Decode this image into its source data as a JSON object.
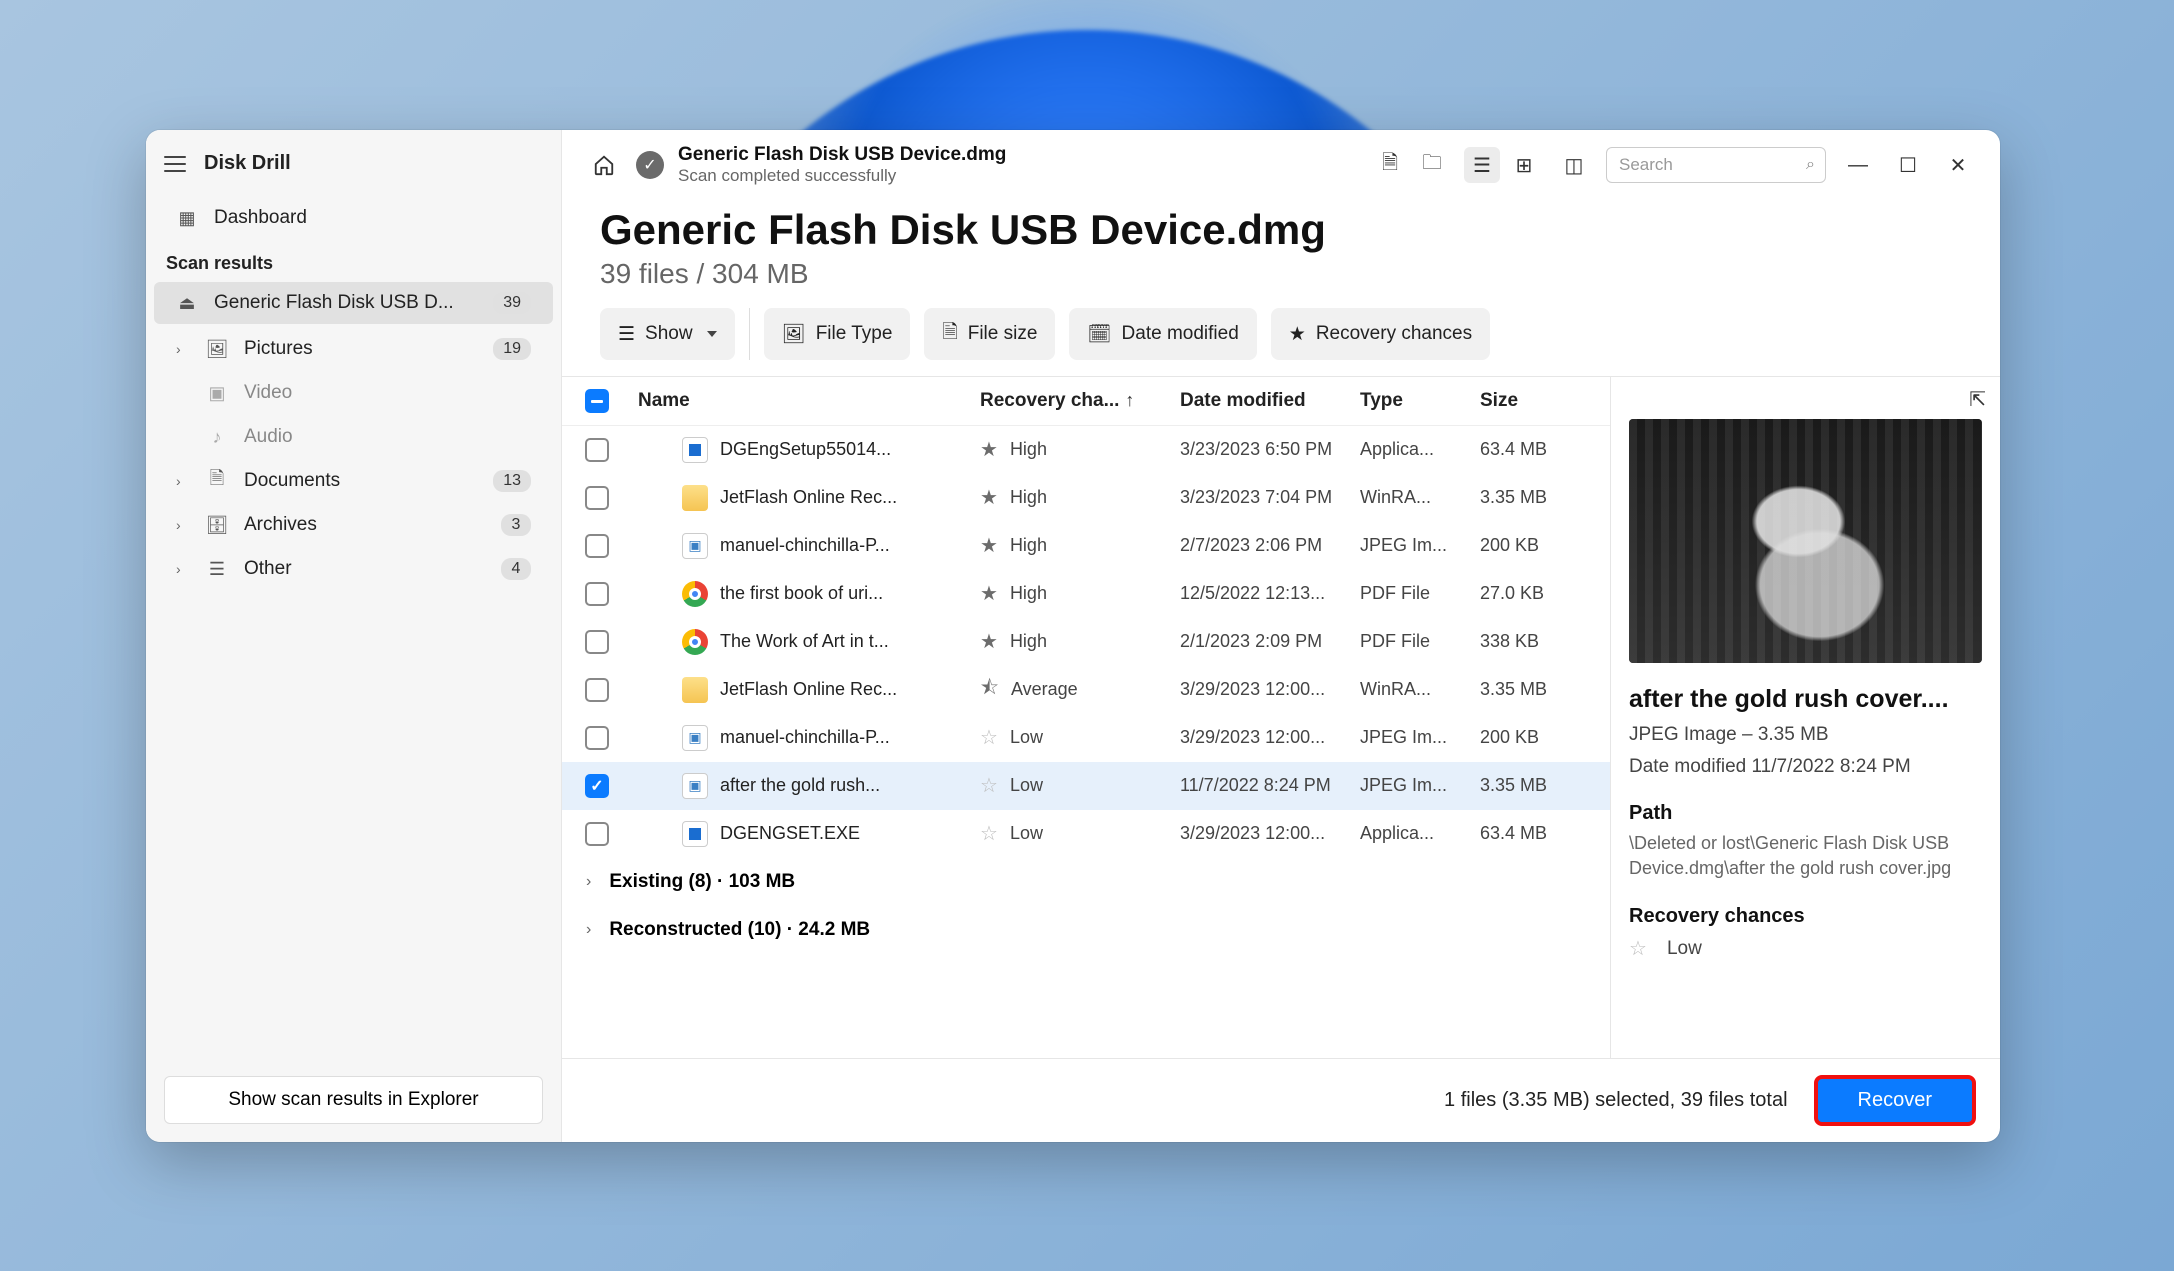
{
  "app_name": "Disk Drill",
  "sidebar": {
    "dashboard": "Dashboard",
    "scan_results_label": "Scan results",
    "drive_item": "Generic Flash Disk USB D...",
    "drive_badge": "39",
    "items": [
      {
        "label": "Pictures",
        "badge": "19",
        "icon": "image-icon",
        "expandable": true
      },
      {
        "label": "Video",
        "badge": "",
        "icon": "video-icon",
        "child": true
      },
      {
        "label": "Audio",
        "badge": "",
        "icon": "audio-icon",
        "child": true
      },
      {
        "label": "Documents",
        "badge": "13",
        "icon": "document-icon",
        "expandable": true
      },
      {
        "label": "Archives",
        "badge": "3",
        "icon": "archive-icon",
        "expandable": true
      },
      {
        "label": "Other",
        "badge": "4",
        "icon": "other-icon",
        "expandable": true
      }
    ],
    "explorer_button": "Show scan results in Explorer"
  },
  "topbar": {
    "title": "Generic Flash Disk USB Device.dmg",
    "subtitle": "Scan completed successfully",
    "search_placeholder": "Search"
  },
  "header": {
    "h1": "Generic Flash Disk USB Device.dmg",
    "h2": "39 files / 304 MB"
  },
  "chips": {
    "show": "Show",
    "file_type": "File Type",
    "file_size": "File size",
    "date_modified": "Date modified",
    "recovery_chances": "Recovery chances"
  },
  "columns": {
    "name": "Name",
    "recovery": "Recovery cha...",
    "date": "Date modified",
    "type": "Type",
    "size": "Size"
  },
  "rows": [
    {
      "name": "DGEngSetup55014...",
      "chance": "High",
      "star": "full",
      "date": "3/23/2023 6:50 PM",
      "type": "Applica...",
      "size": "63.4 MB",
      "icon": "f-exe",
      "checked": false
    },
    {
      "name": "JetFlash Online Rec...",
      "chance": "High",
      "star": "full",
      "date": "3/23/2023 7:04 PM",
      "type": "WinRA...",
      "size": "3.35 MB",
      "icon": "f-zip",
      "checked": false
    },
    {
      "name": "manuel-chinchilla-P...",
      "chance": "High",
      "star": "full",
      "date": "2/7/2023 2:06 PM",
      "type": "JPEG Im...",
      "size": "200 KB",
      "icon": "f-jpg",
      "checked": false
    },
    {
      "name": "the first book of uri...",
      "chance": "High",
      "star": "full",
      "date": "12/5/2022 12:13...",
      "type": "PDF File",
      "size": "27.0 KB",
      "icon": "f-chrome",
      "checked": false
    },
    {
      "name": "The Work of Art in t...",
      "chance": "High",
      "star": "full",
      "date": "2/1/2023 2:09 PM",
      "type": "PDF File",
      "size": "338 KB",
      "icon": "f-chrome",
      "checked": false
    },
    {
      "name": "JetFlash Online Rec...",
      "chance": "Average",
      "star": "half",
      "date": "3/29/2023 12:00...",
      "type": "WinRA...",
      "size": "3.35 MB",
      "icon": "f-zip",
      "checked": false
    },
    {
      "name": "manuel-chinchilla-P...",
      "chance": "Low",
      "star": "empty",
      "date": "3/29/2023 12:00...",
      "type": "JPEG Im...",
      "size": "200 KB",
      "icon": "f-jpg",
      "checked": false
    },
    {
      "name": "after the gold rush...",
      "chance": "Low",
      "star": "empty",
      "date": "11/7/2022 8:24 PM",
      "type": "JPEG Im...",
      "size": "3.35 MB",
      "icon": "f-jpg",
      "checked": true,
      "selected": true
    },
    {
      "name": "DGENGSET.EXE",
      "chance": "Low",
      "star": "empty",
      "date": "3/29/2023 12:00...",
      "type": "Applica...",
      "size": "63.4 MB",
      "icon": "f-exe",
      "checked": false
    }
  ],
  "groups": {
    "existing": "Existing (8) · 103 MB",
    "reconstructed": "Reconstructed (10) · 24.2 MB"
  },
  "preview": {
    "title": "after the gold rush cover....",
    "meta1": "JPEG Image – 3.35 MB",
    "meta2": "Date modified 11/7/2022 8:24 PM",
    "path_label": "Path",
    "path": "\\Deleted or lost\\Generic Flash Disk USB Device.dmg\\after the gold rush cover.jpg",
    "chances_label": "Recovery chances",
    "chances_value": "Low"
  },
  "footer": {
    "status": "1 files (3.35 MB) selected, 39 files total",
    "recover": "Recover"
  }
}
